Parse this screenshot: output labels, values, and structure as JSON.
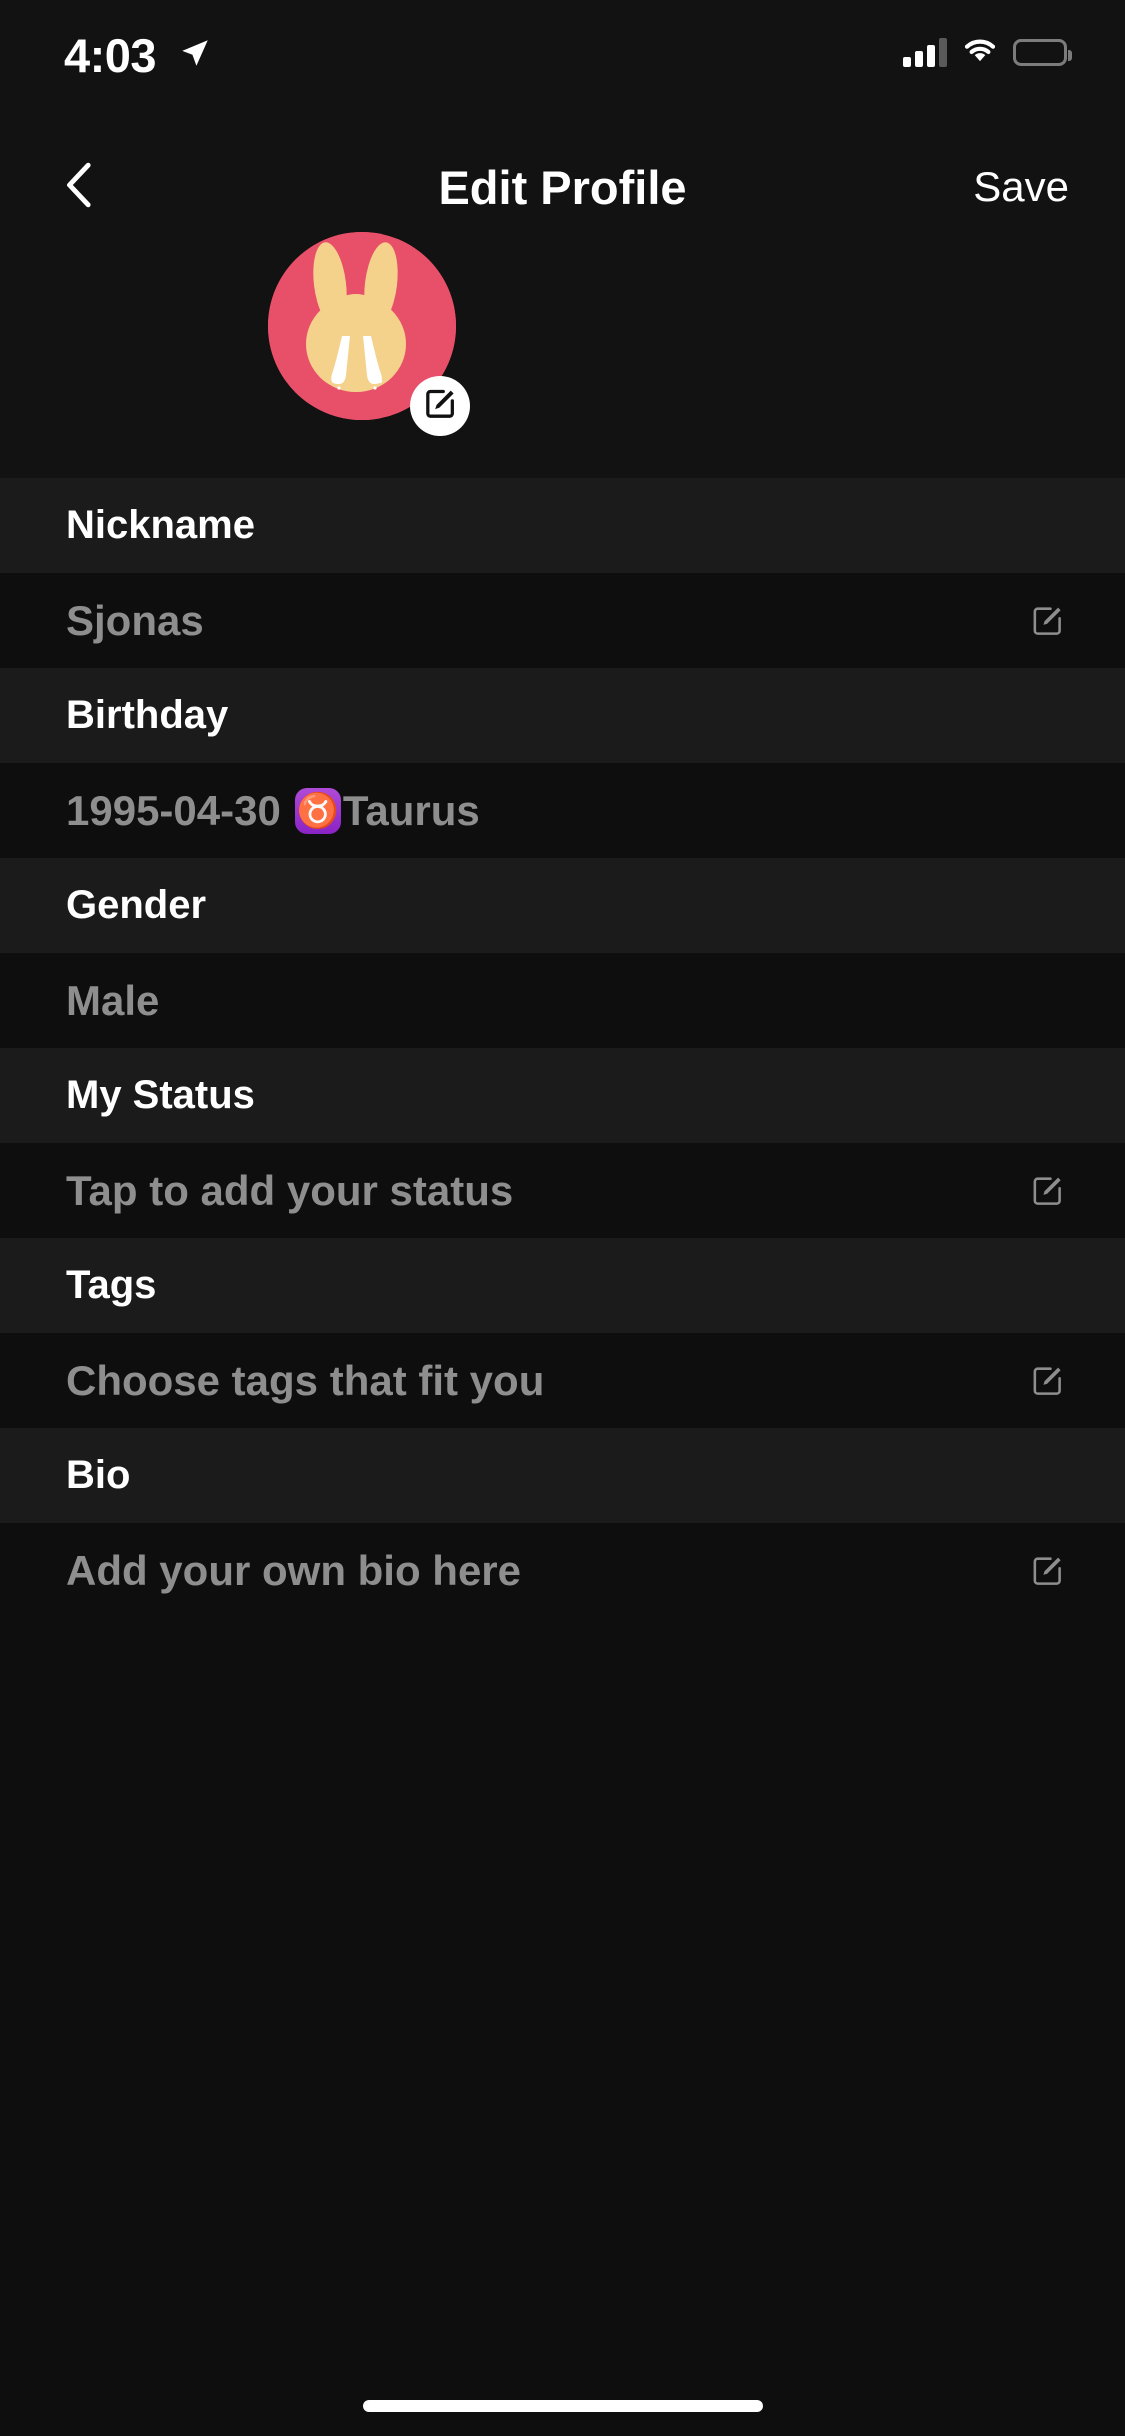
{
  "status_bar": {
    "time": "4:03",
    "location_icon": "location-arrow-icon",
    "cellular_icon": "cellular-bars-icon",
    "wifi_icon": "wifi-icon",
    "battery_icon": "battery-full-icon"
  },
  "header": {
    "back_icon": "chevron-left-icon",
    "title": "Edit Profile",
    "save_label": "Save"
  },
  "avatar": {
    "image_name": "bunny-avatar",
    "background_color": "#E8506A",
    "bunny_color": "#F4D28C",
    "edit_badge_icon": "edit-pencil-icon"
  },
  "colors": {
    "screen_background": "#0e0e0e",
    "label_row_background": "#1b1b1b",
    "value_row_background": "#0e0e0e",
    "label_text": "#ffffff",
    "value_text": "#8e8e8e",
    "accent_pink": "#E8506A",
    "zodiac_purple": "#9B32CE"
  },
  "fields": [
    {
      "label": "Nickname",
      "value": "Sjonas",
      "edit_icon": "edit-square-icon",
      "has_edit_icon": true,
      "has_zodiac": false
    },
    {
      "label": "Birthday",
      "value": "1995-04-30",
      "zodiac_glyph": "♉",
      "zodiac_name": "Taurus",
      "edit_icon": "",
      "has_edit_icon": false,
      "has_zodiac": true
    },
    {
      "label": "Gender",
      "value": "Male",
      "edit_icon": "",
      "has_edit_icon": false,
      "has_zodiac": false
    },
    {
      "label": "My Status",
      "value": "Tap to add your status",
      "edit_icon": "edit-square-icon",
      "has_edit_icon": true,
      "has_zodiac": false
    },
    {
      "label": "Tags",
      "value": "Choose tags that fit you",
      "edit_icon": "edit-square-icon",
      "has_edit_icon": true,
      "has_zodiac": false
    },
    {
      "label": "Bio",
      "value": "Add your own bio here",
      "edit_icon": "edit-square-icon",
      "has_edit_icon": true,
      "has_zodiac": false
    }
  ],
  "home_indicator": "home-indicator-bar"
}
